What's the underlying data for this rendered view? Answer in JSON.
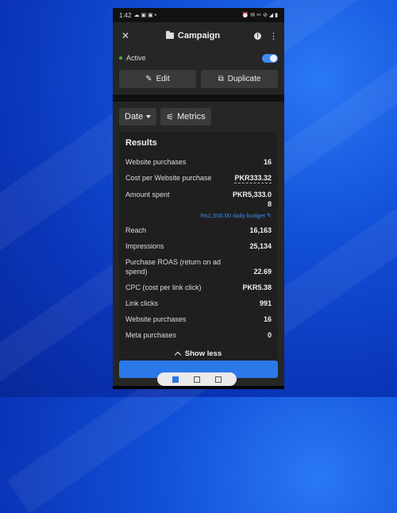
{
  "status": {
    "time": "1:42",
    "left_icons": "☁ ▣ ▣ •",
    "right_icons": "⏰ ✉ ✂ ⊘ ◢ ▮"
  },
  "header": {
    "close_glyph": "✕",
    "title": "Campaign",
    "info_glyph": "!",
    "menu_glyph": "⋮"
  },
  "state": {
    "label": "Active",
    "enabled": true
  },
  "actions": {
    "edit_glyph": "✎",
    "edit": "Edit",
    "duplicate_glyph": "⧉",
    "duplicate": "Duplicate"
  },
  "filters": {
    "date": "Date",
    "metrics_glyph": "⚟",
    "metrics": "Metrics"
  },
  "results": {
    "title": "Results",
    "rows_top": [
      {
        "label": "Website purchases",
        "value": "16"
      },
      {
        "label": "Cost per Website purchase",
        "value": "PKR333.32"
      },
      {
        "label": "Amount spent",
        "value": "PKR5,333.0 8"
      }
    ],
    "budget_note": "Rs1,500.00 daily budget ✎",
    "rows_bottom": [
      {
        "label": "Reach",
        "value": "16,163"
      },
      {
        "label": "Impressions",
        "value": "25,134"
      },
      {
        "label": "Purchase ROAS (return on ad spend)",
        "value": "22.69"
      },
      {
        "label": "CPC (cost per link click)",
        "value": "PKR5.38"
      },
      {
        "label": "Link clicks",
        "value": "991"
      },
      {
        "label": "Website purchases",
        "value": "16"
      },
      {
        "label": "Meta purchases",
        "value": "0"
      }
    ],
    "show_less": "Show less"
  }
}
